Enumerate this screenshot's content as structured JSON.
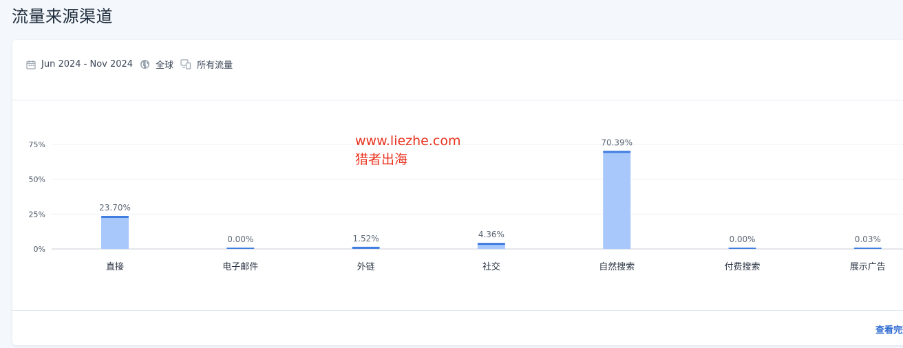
{
  "page": {
    "title": "流量来源渠道"
  },
  "filters": {
    "date_range": "Jun 2024 - Nov 2024",
    "region": "全球",
    "traffic_type": "所有流量",
    "icons": [
      "calendar-icon",
      "globe-icon",
      "devices-icon"
    ]
  },
  "watermark": {
    "line1": "www.liezhe.com",
    "line2": "猎者出海"
  },
  "footer": {
    "link_label": "查看完整"
  },
  "colors": {
    "bar": "#a8c8fb",
    "bar_cap": "#3f7de0",
    "watermark": "#e8321e",
    "link": "#2f6bd1"
  },
  "chart_data": {
    "type": "bar",
    "categories": [
      "直接",
      "电子邮件",
      "外链",
      "社交",
      "自然搜索",
      "付费搜索",
      "展示广告"
    ],
    "values": [
      23.7,
      0.0,
      1.52,
      4.36,
      70.39,
      0.0,
      0.03
    ],
    "value_labels": [
      "23.70%",
      "0.00%",
      "1.52%",
      "4.36%",
      "70.39%",
      "0.00%",
      "0.03%"
    ],
    "yticks": [
      "0%",
      "25%",
      "50%",
      "75%"
    ],
    "ytick_values": [
      0,
      25,
      50,
      75
    ],
    "ylim": [
      0,
      75
    ],
    "grid": true,
    "title": "",
    "xlabel": "",
    "ylabel": ""
  }
}
